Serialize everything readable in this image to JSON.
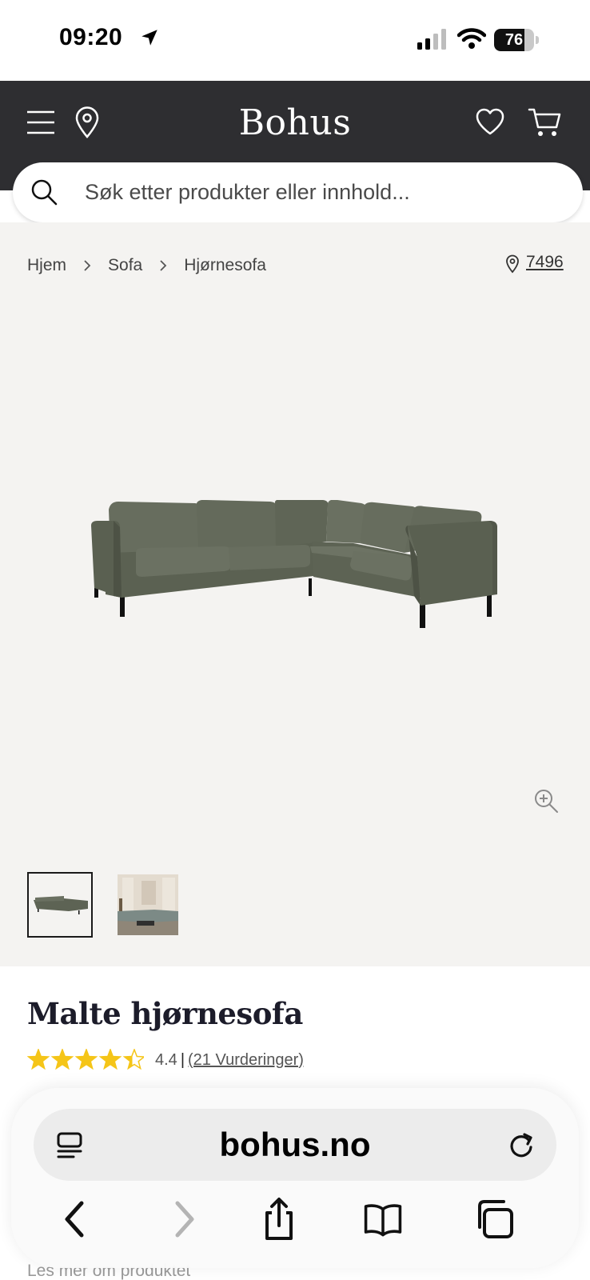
{
  "status_bar": {
    "time": "09:20",
    "battery": "76",
    "battery_level": 0.76
  },
  "header": {
    "logo": "Bohus"
  },
  "search": {
    "placeholder": "Søk etter produkter eller innhold..."
  },
  "breadcrumb": {
    "items": [
      "Hjem",
      "Sofa",
      "Hjørnesofa"
    ],
    "store_code": "7496"
  },
  "product": {
    "title": "Malte hjørnesofa",
    "rating_value": "4.4",
    "rating_separator": "|",
    "rating_count": "(21 Vurderinger)",
    "rating_stars": 4.4,
    "read_more": "Les mer om produktet"
  },
  "browser": {
    "url": "bohus.no"
  },
  "colors": {
    "header_bg": "#2e2e31",
    "gallery_bg": "#f4f3f1",
    "star": "#f5c518",
    "sofa": "#5d6354"
  }
}
